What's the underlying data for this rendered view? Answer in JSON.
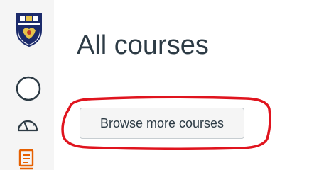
{
  "page": {
    "title": "All courses"
  },
  "actions": {
    "browse_label": "Browse more courses"
  },
  "sidebar": {
    "items": [
      {
        "icon": "university-crest-icon"
      },
      {
        "icon": "account-avatar-icon"
      },
      {
        "icon": "dashboard-icon"
      },
      {
        "icon": "courses-icon",
        "active": true
      }
    ]
  },
  "colors": {
    "text": "#2d3b45",
    "sidebar_bg": "#f5f5f5",
    "active_icon": "#e66000",
    "highlight": "#e0141e",
    "button_bg": "#f5f5f5",
    "divider": "#c7cdd1"
  }
}
